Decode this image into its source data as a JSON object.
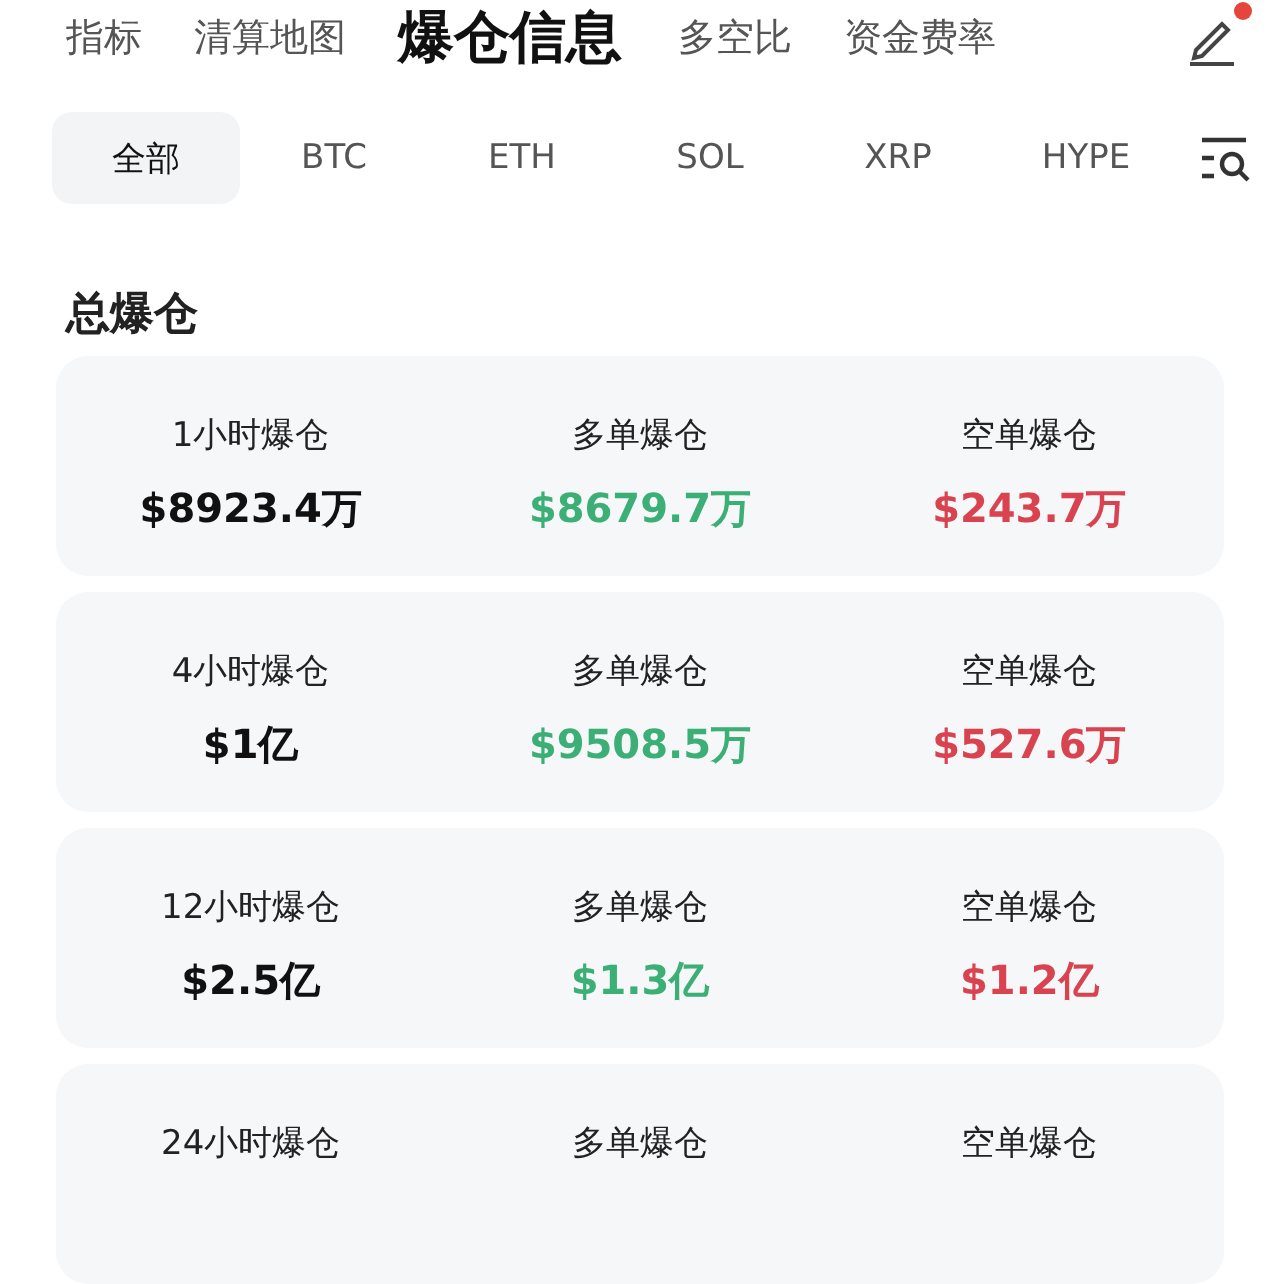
{
  "nav_tabs": [
    {
      "label": "指标",
      "selected": false
    },
    {
      "label": "清算地图",
      "selected": false
    },
    {
      "label": "爆仓信息",
      "selected": true
    },
    {
      "label": "多空比",
      "selected": false
    },
    {
      "label": "资金费率",
      "selected": false
    }
  ],
  "edit_badge": true,
  "coin_tabs": [
    {
      "label": "全部",
      "selected": true
    },
    {
      "label": "BTC",
      "selected": false
    },
    {
      "label": "ETH",
      "selected": false
    },
    {
      "label": "SOL",
      "selected": false
    },
    {
      "label": "XRP",
      "selected": false
    },
    {
      "label": "HYPE",
      "selected": false
    }
  ],
  "section_title": "总爆仓",
  "cards": [
    {
      "period": "1小时爆仓",
      "total": "$8923.4万",
      "long_label": "多单爆仓",
      "long": "$8679.7万",
      "short_label": "空单爆仓",
      "short": "$243.7万"
    },
    {
      "period": "4小时爆仓",
      "total": "$1亿",
      "long_label": "多单爆仓",
      "long": "$9508.5万",
      "short_label": "空单爆仓",
      "short": "$527.6万"
    },
    {
      "period": "12小时爆仓",
      "total": "$2.5亿",
      "long_label": "多单爆仓",
      "long": "$1.3亿",
      "short_label": "空单爆仓",
      "short": "$1.2亿"
    },
    {
      "period": "24小时爆仓",
      "long_label": "多单爆仓",
      "short_label": "空单爆仓"
    }
  ]
}
